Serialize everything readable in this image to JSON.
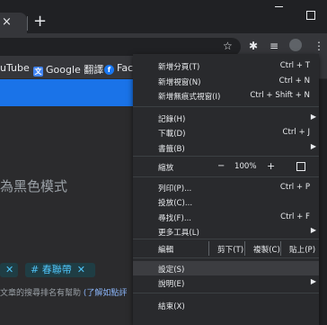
{
  "tabstrip": {
    "close_glyph": "×",
    "new_tab_glyph": "+",
    "window_close_glyph": "✕"
  },
  "bookmarks": [
    {
      "label": "uTube"
    },
    {
      "label": "Google 翻譯"
    },
    {
      "label": "Face"
    }
  ],
  "page": {
    "dark_mode_text": "為黑色模式",
    "tags": [
      {
        "label": "",
        "close": "✕"
      },
      {
        "label": "# 春聯帶",
        "close": "✕"
      }
    ],
    "help_text": "文章的搜尋排名有幫助",
    "help_link": "(了解如點評"
  },
  "menu": {
    "items_top": [
      {
        "label": "新增分頁(T)",
        "shortcut": "Ctrl + T"
      },
      {
        "label": "新增視窗(N)",
        "shortcut": "Ctrl + N"
      },
      {
        "label": "新增無痕式視窗(I)",
        "shortcut": "Ctrl + Shift + N"
      }
    ],
    "history": "記錄(H)",
    "downloads": {
      "label": "下載(D)",
      "shortcut": "Ctrl + J"
    },
    "bookmarks": "書籤(B)",
    "zoom": {
      "label": "縮放",
      "minus": "−",
      "value": "100%",
      "plus": "+"
    },
    "print": {
      "label": "列印(P)...",
      "shortcut": "Ctrl + P"
    },
    "cast": "投放(C)...",
    "find": {
      "label": "尋找(F)...",
      "shortcut": "Ctrl + F"
    },
    "more_tools": "更多工具(L)",
    "edit": {
      "label": "編輯",
      "cut": "剪下(T)",
      "copy": "複製(C)",
      "paste": "貼上(P)"
    },
    "settings": "設定(S)",
    "help": "說明(E)",
    "exit": "結束(X)"
  }
}
